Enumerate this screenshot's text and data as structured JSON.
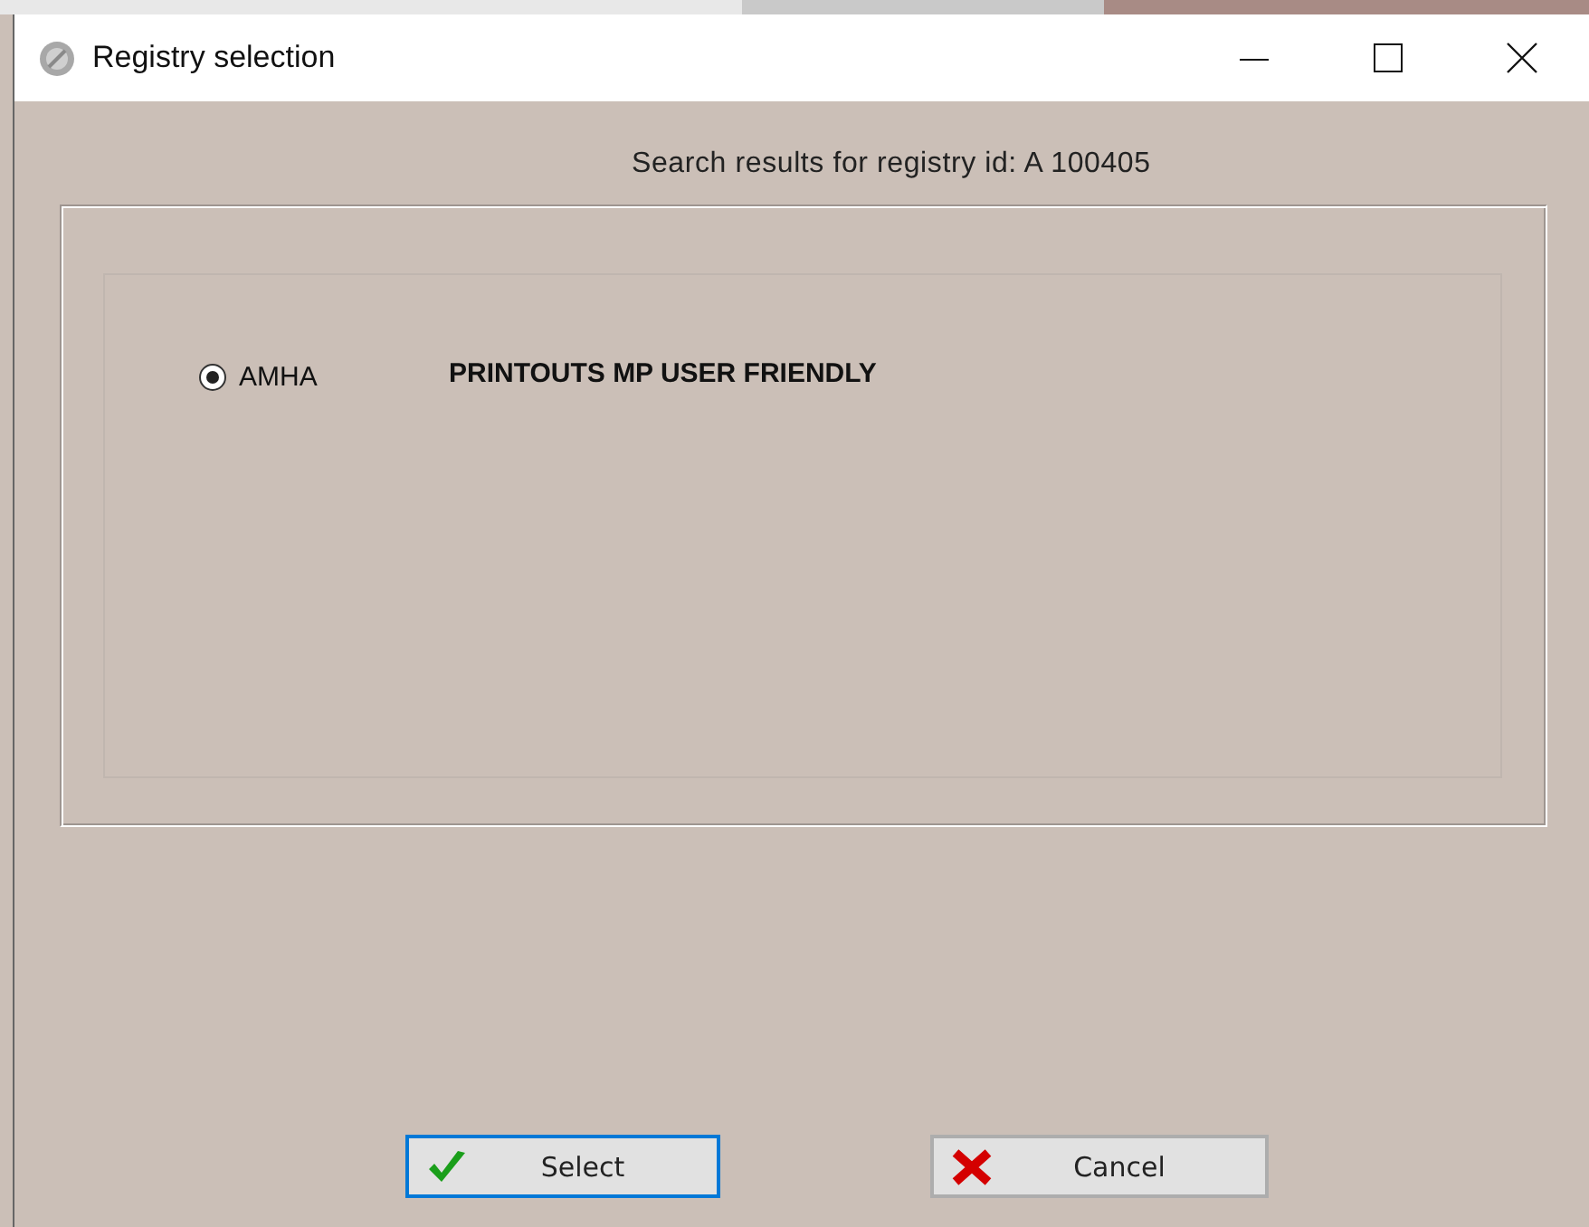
{
  "window": {
    "title": "Registry selection"
  },
  "header": "Search results for registry id: A 100405",
  "results": [
    {
      "code": "AMHA",
      "description": "PRINTOUTS MP USER FRIENDLY",
      "selected": true
    }
  ],
  "buttons": [
    {
      "label": "Select",
      "kind": "confirm",
      "focused": true
    },
    {
      "label": "Cancel",
      "kind": "cancel",
      "focused": false
    }
  ]
}
